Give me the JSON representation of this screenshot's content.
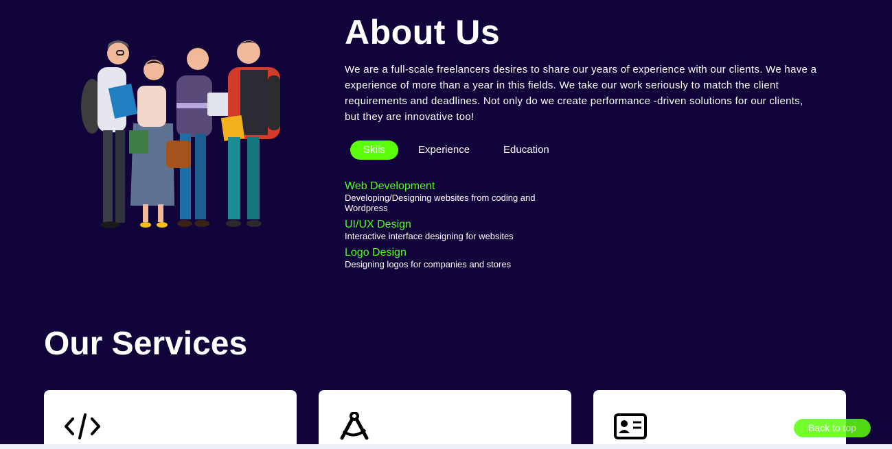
{
  "about": {
    "title": "About Us",
    "text": "We are a full-scale freelancers desires to share our years of experience with our clients. We have a experience of more than a year in this fields. We take our work seriously to match the client requirements and deadlines. Not only do we create performance -driven solutions for our clients, but they are innovative too!",
    "tabs": [
      {
        "label": "Skils",
        "active": true
      },
      {
        "label": "Experience",
        "active": false
      },
      {
        "label": "Education",
        "active": false
      }
    ],
    "skills": [
      {
        "title": "Web Development",
        "desc": "Developing/Designing websites from coding and Wordpress"
      },
      {
        "title": "UI/UX Design",
        "desc": "Interactive interface designing for websites"
      },
      {
        "title": "Logo Design",
        "desc": "Designing logos for companies and stores"
      }
    ]
  },
  "services": {
    "title": "Our Services",
    "cards": [
      {
        "icon": "code-icon"
      },
      {
        "icon": "compass-drafting-icon"
      },
      {
        "icon": "id-card-icon"
      }
    ]
  },
  "back_to_top": "Back to top",
  "colors": {
    "background": "#10043a",
    "accent": "#5cff0a",
    "skill_title": "#4dff1a",
    "card": "#ffffff"
  }
}
